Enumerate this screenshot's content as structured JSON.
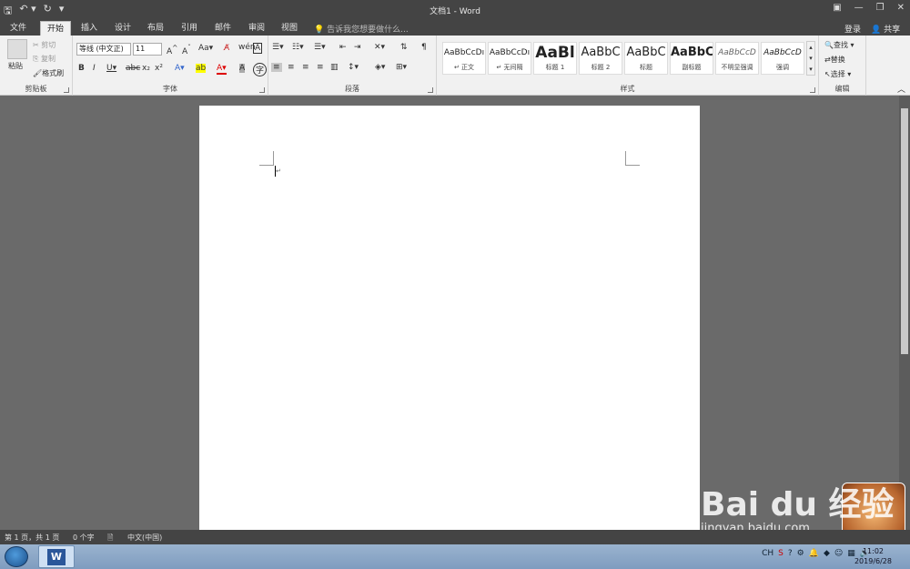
{
  "window": {
    "title": "文档1 - Word"
  },
  "qat": {
    "save": "🖫",
    "undo": "↶ ▾",
    "redo": "↻",
    "customize": "▾"
  },
  "winbtns": {
    "ribbon_opts": "▣",
    "minimize": "—",
    "restore": "❐",
    "close": "✕"
  },
  "tabs": [
    "文件",
    "开始",
    "插入",
    "设计",
    "布局",
    "引用",
    "邮件",
    "审阅",
    "视图"
  ],
  "tell_me": "告诉我您想要做什么...",
  "account": {
    "login": "登录",
    "share": "共享"
  },
  "clipboard": {
    "paste": "粘贴",
    "cut": "剪切",
    "copy": "复制",
    "format_painter": "格式刷",
    "label": "剪贴板"
  },
  "font": {
    "name": "等线 (中文正)",
    "size": "11",
    "label": "字体"
  },
  "paragraph": {
    "label": "段落"
  },
  "styles": {
    "label": "样式",
    "items": [
      {
        "preview": "AaBbCcDı",
        "name": "↵ 正文"
      },
      {
        "preview": "AaBbCcDı",
        "name": "↵ 无间隔"
      },
      {
        "preview": "AaBl",
        "name": "标题 1"
      },
      {
        "preview": "AaBbC",
        "name": "标题 2"
      },
      {
        "preview": "AaBbC",
        "name": "标题"
      },
      {
        "preview": "AaBbC",
        "name": "副标题"
      },
      {
        "preview": "AaBbCcD",
        "name": "不明显强调"
      },
      {
        "preview": "AaBbCcD",
        "name": "强调"
      }
    ]
  },
  "editing": {
    "find": "查找",
    "replace": "替换",
    "select": "选择",
    "label": "编辑"
  },
  "status": {
    "page": "第 1 页，共 1 页",
    "words": "0 个字",
    "lang": "中文(中国)"
  },
  "taskbar": {
    "time": "11:02",
    "date": "2019/6/28",
    "ime": "CH"
  },
  "watermark": {
    "brand": "Bai du 经验",
    "url": "jingyan.baidu.com"
  }
}
